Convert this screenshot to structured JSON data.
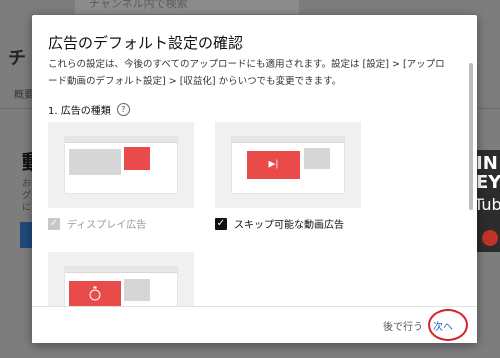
{
  "background": {
    "search_placeholder": "チャンネル内で検索",
    "title_fragment": "チ",
    "tab_fragment": "概要",
    "card_letter": "動",
    "card_lines": [
      "お",
      "グ",
      "に"
    ],
    "thumb_line1": "IN EY",
    "thumb_line2": "Tub"
  },
  "dialog": {
    "title": "広告のデフォルト設定の確認",
    "description": "これらの設定は、今後のすべてのアップロードにも適用されます。設定は [設定] > [アップロード動画のデフォルト設定] > [収益化] からいつでも変更できます。",
    "section_title": "1. 広告の種類",
    "help_icon_glyph": "?",
    "options": [
      {
        "label": "ディスプレイ広告",
        "checked": true,
        "disabled": true
      },
      {
        "label": "スキップ可能な動画広告",
        "checked": true,
        "disabled": false
      }
    ],
    "check_glyph": "✓",
    "play_glyph": "▶|",
    "buttons": {
      "later": "後で行う",
      "next": "次へ"
    }
  },
  "colors": {
    "accent_red": "#e94a4a",
    "link_blue": "#1a66d2",
    "highlight_ring": "#d8232a"
  }
}
